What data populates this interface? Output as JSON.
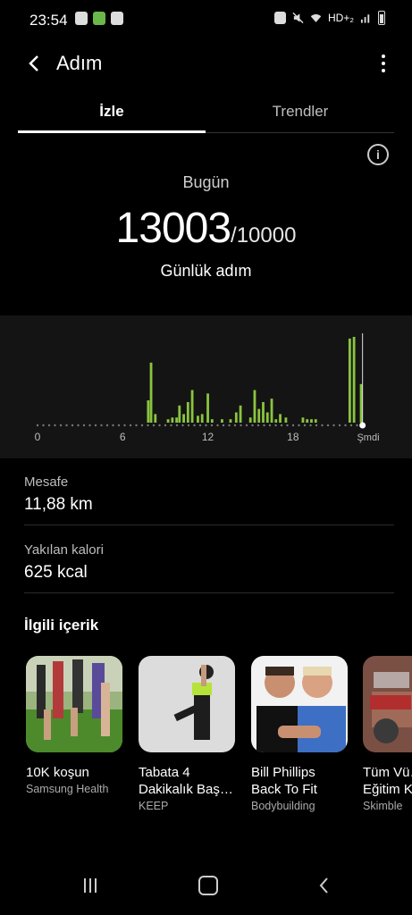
{
  "status": {
    "time": "23:54",
    "network": "HD+₂"
  },
  "appbar": {
    "title": "Adım"
  },
  "tabs": [
    {
      "label": "İzle"
    },
    {
      "label": "Trendler"
    }
  ],
  "summary": {
    "day_label": "Bugün",
    "steps": "13003",
    "goal": "/10000",
    "unit_label": "Günlük adım"
  },
  "chart_data": {
    "type": "bar",
    "x_ticks": [
      "0",
      "6",
      "12",
      "18",
      "Şmdi"
    ],
    "bar_color": "#8ac43f",
    "bars": [
      {
        "h": 7.8,
        "v": 0.26
      },
      {
        "h": 8.0,
        "v": 0.7
      },
      {
        "h": 8.3,
        "v": 0.1
      },
      {
        "h": 9.2,
        "v": 0.04
      },
      {
        "h": 9.5,
        "v": 0.06
      },
      {
        "h": 9.8,
        "v": 0.06
      },
      {
        "h": 10.0,
        "v": 0.2
      },
      {
        "h": 10.3,
        "v": 0.1
      },
      {
        "h": 10.6,
        "v": 0.24
      },
      {
        "h": 10.9,
        "v": 0.38
      },
      {
        "h": 11.3,
        "v": 0.08
      },
      {
        "h": 11.6,
        "v": 0.1
      },
      {
        "h": 12.0,
        "v": 0.34
      },
      {
        "h": 12.3,
        "v": 0.04
      },
      {
        "h": 13.0,
        "v": 0.04
      },
      {
        "h": 13.6,
        "v": 0.04
      },
      {
        "h": 14.0,
        "v": 0.12
      },
      {
        "h": 14.3,
        "v": 0.2
      },
      {
        "h": 15.0,
        "v": 0.06
      },
      {
        "h": 15.3,
        "v": 0.38
      },
      {
        "h": 15.6,
        "v": 0.16
      },
      {
        "h": 15.9,
        "v": 0.24
      },
      {
        "h": 16.2,
        "v": 0.12
      },
      {
        "h": 16.5,
        "v": 0.28
      },
      {
        "h": 16.8,
        "v": 0.04
      },
      {
        "h": 17.1,
        "v": 0.1
      },
      {
        "h": 17.5,
        "v": 0.06
      },
      {
        "h": 18.7,
        "v": 0.06
      },
      {
        "h": 19.0,
        "v": 0.04
      },
      {
        "h": 19.3,
        "v": 0.04
      },
      {
        "h": 19.6,
        "v": 0.04
      },
      {
        "h": 22.0,
        "v": 0.98
      },
      {
        "h": 22.3,
        "v": 1.0
      },
      {
        "h": 22.8,
        "v": 0.45
      }
    ]
  },
  "metrics": [
    {
      "label": "Mesafe",
      "value": "11,88 km"
    },
    {
      "label": "Yakılan kalori",
      "value": "625 kcal"
    }
  ],
  "related": {
    "title": "İlgili içerik",
    "cards": [
      {
        "title": "10K koşun",
        "source": "Samsung Health"
      },
      {
        "title": "Tabata 4 Dakikalık Baş…",
        "source": "KEEP"
      },
      {
        "title": "Bill Phillips Back To Fit",
        "source": "Bodybuilding"
      },
      {
        "title": "Tüm Vü… Eğitim K…",
        "source": "Skimble"
      }
    ]
  }
}
